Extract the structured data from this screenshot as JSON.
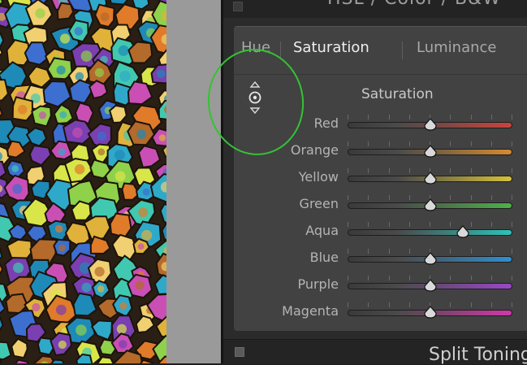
{
  "panel": {
    "header_title": "HSL / Color / B&W",
    "tabs": [
      {
        "label": "Hue",
        "active": false
      },
      {
        "label": "Saturation",
        "active": true
      },
      {
        "label": "Luminance",
        "active": false
      }
    ],
    "section_title": "Saturation",
    "target_tool_icon": "target-adjustment-icon",
    "sliders": [
      {
        "label": "Red",
        "value_fraction": 0.5,
        "color": "#c8443c"
      },
      {
        "label": "Orange",
        "value_fraction": 0.5,
        "color": "#d48a30"
      },
      {
        "label": "Yellow",
        "value_fraction": 0.5,
        "color": "#d6c138"
      },
      {
        "label": "Green",
        "value_fraction": 0.5,
        "color": "#4fb04a"
      },
      {
        "label": "Aqua",
        "value_fraction": 0.7,
        "color": "#2fc2b8"
      },
      {
        "label": "Blue",
        "value_fraction": 0.5,
        "color": "#2f8fd0"
      },
      {
        "label": "Purple",
        "value_fraction": 0.5,
        "color": "#9a48c8"
      },
      {
        "label": "Magenta",
        "value_fraction": 0.5,
        "color": "#d038a8"
      }
    ]
  },
  "footer": {
    "title": "Split Toning"
  },
  "colors": {
    "highlight": "#35c235",
    "panel_bg": "#2b2b2b",
    "box_bg": "#424242"
  }
}
